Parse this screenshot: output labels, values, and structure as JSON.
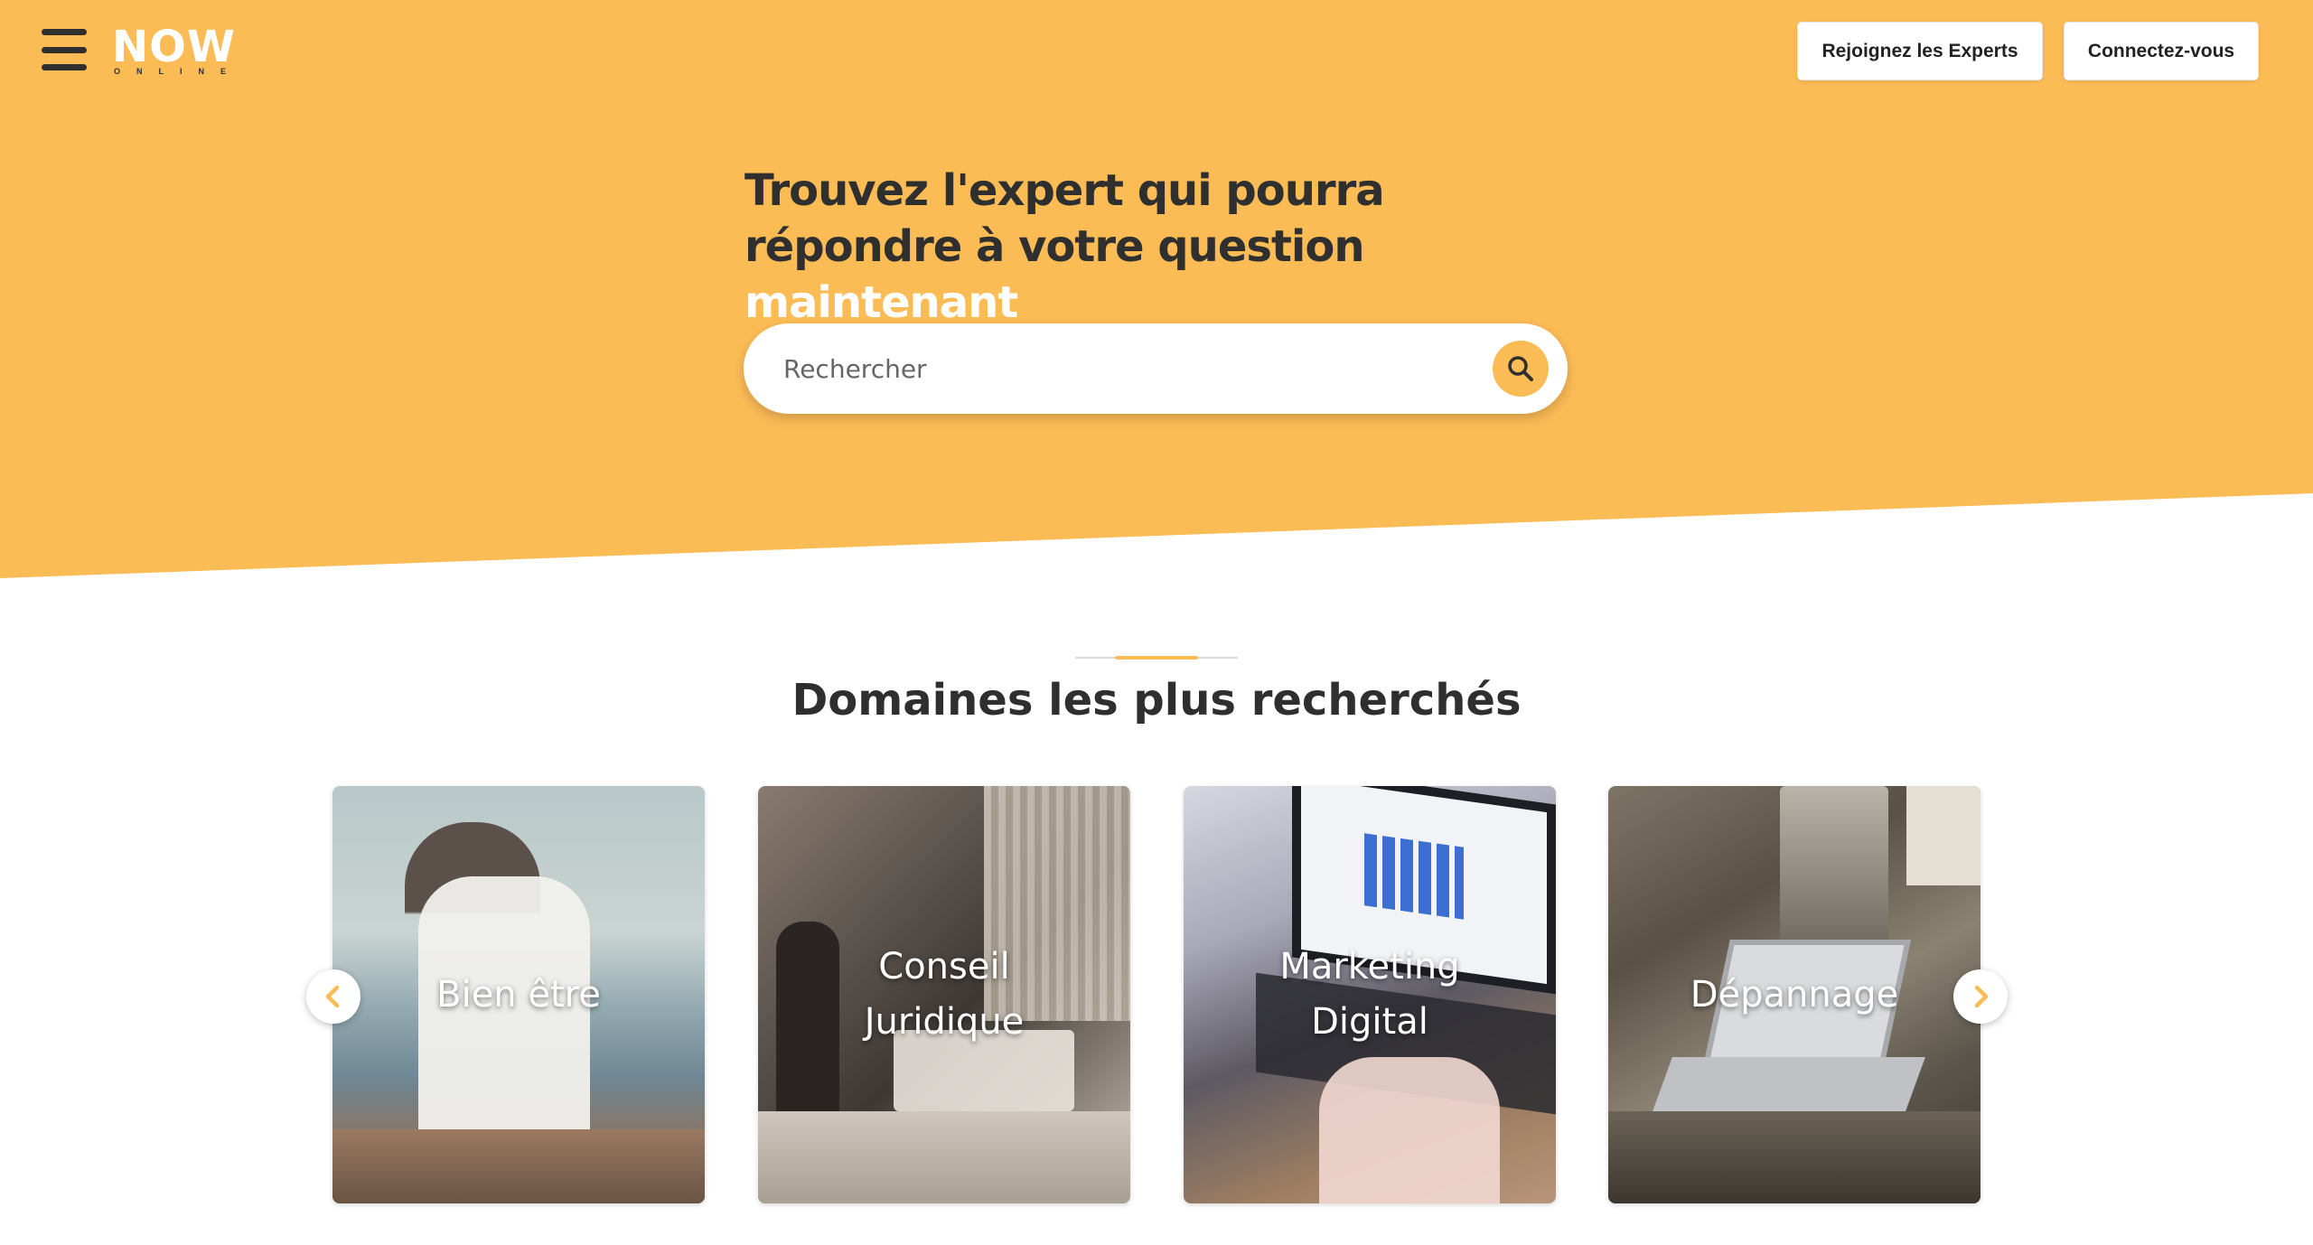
{
  "header": {
    "menu_icon": "hamburger-menu-icon",
    "logo": {
      "word": "NOW",
      "sub": "ONLINE"
    },
    "buttons": {
      "join_label": "Rejoignez les Experts",
      "login_label": "Connectez-vous"
    }
  },
  "hero": {
    "headline_part1": "Trouvez l'expert qui pourra répondre à votre question ",
    "headline_highlight": "maintenant",
    "search": {
      "placeholder": "Rechercher",
      "icon": "search-icon"
    }
  },
  "section": {
    "title": "Domaines les plus recherchés"
  },
  "carousel": {
    "prev_icon": "chevron-left-icon",
    "next_icon": "chevron-right-icon",
    "cards": [
      {
        "label": "Bien être"
      },
      {
        "label": "Conseil Juridique"
      },
      {
        "label": "Marketing Digital"
      },
      {
        "label": "Dépannage"
      }
    ]
  },
  "colors": {
    "accent": "#fbbb55",
    "dark_text": "#2f2f2f",
    "white": "#ffffff"
  }
}
